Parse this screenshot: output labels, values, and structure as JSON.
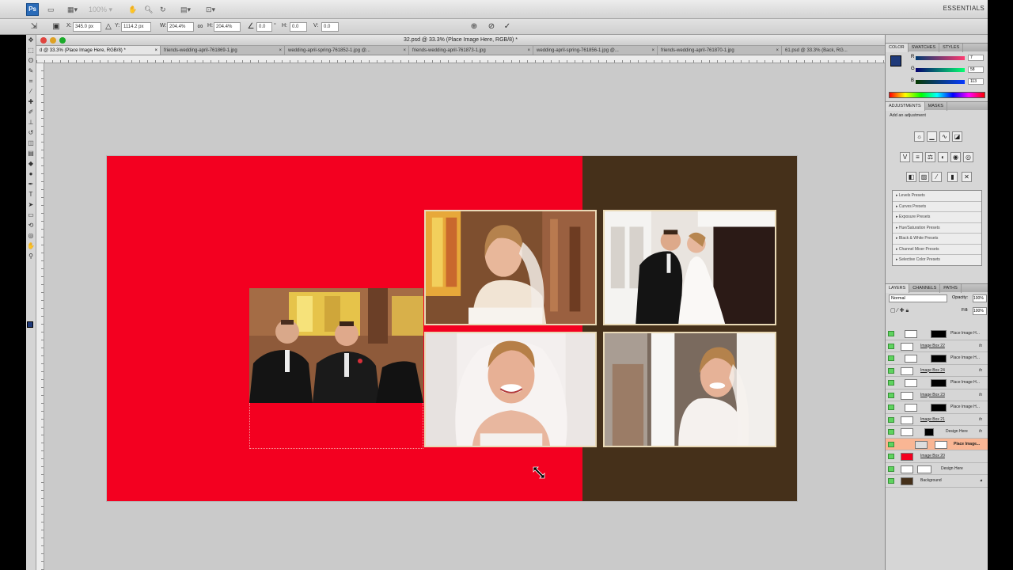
{
  "app": {
    "logo": "Ps",
    "essentials": "ESSENTIALS"
  },
  "optbar": {
    "x_label": "X:",
    "x_value": "345.0 px",
    "y_label": "Y:",
    "y_value": "1114.2 px",
    "w_label": "W:",
    "w_value": "204.4%",
    "h_label": "H:",
    "h_value": "204.4%",
    "angle_value": "0.0",
    "h_skew_value": "0.0",
    "v_skew_value": "0.0",
    "degree_sign": "°"
  },
  "document": {
    "title": "32.psd @ 33.3% (Place Image Here, RGB/8) *",
    "tabs": [
      {
        "label": "d @ 33.3% (Place Image Here, RGB/8) *",
        "active": true
      },
      {
        "label": "friends-wedding-april-761869-1.jpg"
      },
      {
        "label": "wedding-april-spring-761852-1.jpg @..."
      },
      {
        "label": "friends-wedding-april-761873-1.jpg"
      },
      {
        "label": "wedding-april-spring-761856-1.jpg @..."
      },
      {
        "label": "friends-wedding-april-761870-1.jpg"
      },
      {
        "label": "61.psd @ 33.3% (Back, RG..."
      }
    ]
  },
  "canvas": {
    "red": "#f30020",
    "brown": "#45301a"
  },
  "color_panel": {
    "tabs": [
      "COLOR",
      "SWATCHES",
      "STYLES"
    ],
    "r_label": "R",
    "g_label": "G",
    "b_label": "B",
    "r_value": "7",
    "g_value": "58",
    "b_value": "113"
  },
  "adjustments": {
    "tabs": [
      "ADJUSTMENTS",
      "MASKS"
    ],
    "header": "Add an adjustment",
    "presets": [
      "Levels Presets",
      "Curves Presets",
      "Exposure Presets",
      "Hue/Saturation Presets",
      "Black & White Presets",
      "Channel Mixer Presets",
      "Selective Color Presets"
    ]
  },
  "layers": {
    "tabs": [
      "LAYERS",
      "CHANNELS",
      "PATHS"
    ],
    "blend_mode": "Normal",
    "opacity_label": "Opacity:",
    "opacity_value": "100%",
    "fill_label": "Fill:",
    "fill_value": "100%",
    "fx": "fx",
    "items": [
      {
        "name": "Place Image H...",
        "type": "mask"
      },
      {
        "name": "Image Box 22",
        "type": "box"
      },
      {
        "name": "Place Image H...",
        "type": "mask"
      },
      {
        "name": "Image Box 24",
        "type": "box"
      },
      {
        "name": "Place Image H...",
        "type": "mask"
      },
      {
        "name": "Image Box 23",
        "type": "box"
      },
      {
        "name": "Place Image H...",
        "type": "mask"
      },
      {
        "name": "Image Box 21",
        "type": "box"
      },
      {
        "name": "Design Here",
        "type": "design"
      },
      {
        "name": "Place Image...",
        "type": "selected"
      },
      {
        "name": "Image Box 20",
        "type": "red"
      },
      {
        "name": "Design Here",
        "type": "design"
      },
      {
        "name": "Background",
        "type": "bg"
      }
    ]
  }
}
